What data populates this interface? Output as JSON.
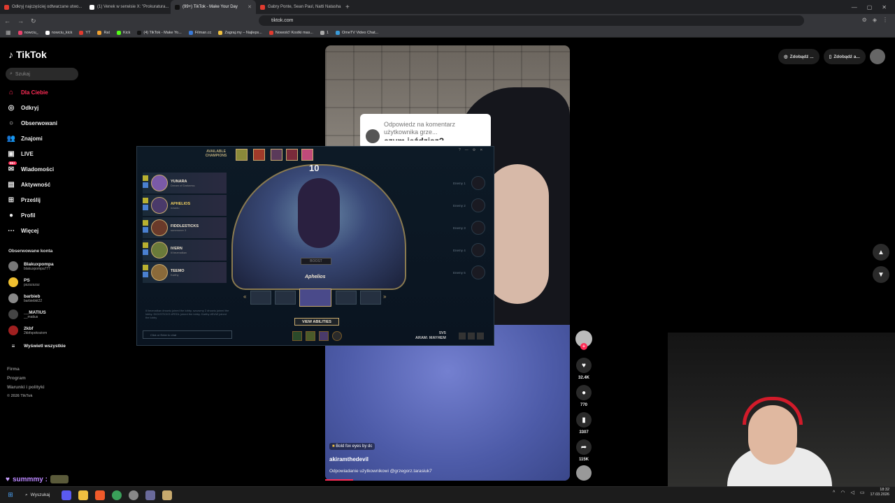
{
  "browser": {
    "tabs": [
      {
        "label": "Odkryj najczęściej odtwarzane utwo...",
        "color": "#e03b2f"
      },
      {
        "label": "(1) Venek w serwisie X: \"Prokuratura...",
        "color": "#ffffff"
      },
      {
        "label": "(99+) TikTok - Make Your Day",
        "color": "#111111",
        "active": true
      },
      {
        "label": "Gabry Ponte, Sean Paul, Natti Natasha...",
        "color": "#e03b2f"
      }
    ],
    "new_tab": "+",
    "url": "tiktok.com",
    "bookmarks": [
      {
        "label": "nowciu_",
        "color": "#e8436c"
      },
      {
        "label": "nowciu_kick",
        "color": "#ffffff"
      },
      {
        "label": "YT",
        "color": "#e03b2f"
      },
      {
        "label": "Rat",
        "color": "#f0a030"
      },
      {
        "label": "Kick",
        "color": "#53fc18"
      },
      {
        "label": "(4) TikTok - Make Yo...",
        "color": "#111111"
      },
      {
        "label": "Filman.cc",
        "color": "#3a7ad8"
      },
      {
        "label": "Zagraj.my – Najleps...",
        "color": "#f0c040"
      },
      {
        "label": "Nowość! Kostki mas...",
        "color": "#e03b2f"
      },
      {
        "label": "1",
        "color": "#aaaaaa"
      },
      {
        "label": "OmeTV Video Chat...",
        "color": "#3a9ad8"
      }
    ]
  },
  "tiktok": {
    "logo": "TikTok",
    "search_placeholder": "Szukaj",
    "nav": [
      {
        "label": "Dla Ciebie",
        "icon": "home-icon",
        "glyph": "⌂",
        "active": true
      },
      {
        "label": "Odkryj",
        "icon": "compass-icon",
        "glyph": "◎"
      },
      {
        "label": "Obserwowani",
        "icon": "following-icon",
        "glyph": "○"
      },
      {
        "label": "Znajomi",
        "icon": "friends-icon",
        "glyph": "👥"
      },
      {
        "label": "LIVE",
        "icon": "live-icon",
        "glyph": "▣"
      },
      {
        "label": "Wiadomości",
        "icon": "messages-icon",
        "glyph": "✉",
        "badge": "99+"
      },
      {
        "label": "Aktywność",
        "icon": "activity-icon",
        "glyph": "▤"
      },
      {
        "label": "Prześlij",
        "icon": "upload-icon",
        "glyph": "⊞"
      },
      {
        "label": "Profil",
        "icon": "profile-icon",
        "glyph": "●"
      },
      {
        "label": "Więcej",
        "icon": "more-icon",
        "glyph": "⋯"
      }
    ],
    "followed_header": "Obserwowane konta",
    "followed": [
      {
        "name": "Blakuxpompa",
        "handle": "blakuxpompa777",
        "color": "#777"
      },
      {
        "name": "PS",
        "handle": "pszszszsz",
        "color": "#f0c030"
      },
      {
        "name": "barbieb",
        "handle": "barbiebkt22",
        "color": "#888"
      },
      {
        "name": "__MATIUS",
        "handle": "__matius",
        "color": "#444"
      },
      {
        "name": "2kbf",
        "handle": "2kbfspokoziom",
        "color": "#a02020"
      }
    ],
    "show_all": "Wyświetl wszystkie",
    "footer": [
      "Firma",
      "Program",
      "Warunki i polityki",
      "© 2026 TikTok"
    ],
    "top_right": [
      "Zdobądź ...",
      "Zdobądź a..."
    ],
    "video": {
      "reply_text": "Odpowiedz na komentarz użytkownika grze...",
      "reply_partial": "czym jeździsz?",
      "tag": "Bold fox eyes by dc",
      "author": "akiramthedevil",
      "caption": "Odpowiadanie użytkownikowi @grzegorz.tarasiuk7"
    },
    "actions": {
      "likes": "32.4K",
      "comments": "770",
      "saves": "3307",
      "shares": "115K"
    }
  },
  "game": {
    "header": "AVAILABLE CHAMPIONS",
    "timer": "10",
    "team": [
      {
        "name": "YUNARA",
        "sub": "Dream of Darkness",
        "color": "#7a5aa8"
      },
      {
        "name": "APHELIOS",
        "sub": "nowciu",
        "color": "#4a3a6a",
        "highlight": true
      },
      {
        "name": "FIDDLESTICKS",
        "sub": "summoner 3",
        "color": "#6a3a2a"
      },
      {
        "name": "IVERN",
        "sub": "lil bezmatkav",
        "color": "#6a7a3a"
      },
      {
        "name": "TEEMO",
        "sub": "Karthy",
        "color": "#8a6a3a"
      }
    ],
    "enemies": [
      "Enemy 1",
      "Enemy 2",
      "Enemy 3",
      "Enemy 4",
      "Enemy 5"
    ],
    "boost": "BOOST",
    "champion": "Aphelios",
    "chat_log": "lil bezmatkav #nowiu joined the lobby. szczurny 2 #nowiu joined the lobby. DICKSTICKS #FEDL joined the lobby. Karthy #EUW joined the lobby",
    "chat_input": "Click or Enter to chat",
    "view_abilities": "VIEW ABILITIES",
    "mode_line1": "5V5",
    "mode_line2": "ARAM: MAYHEM"
  },
  "stream": {
    "chat_user": "summmy :"
  },
  "taskbar": {
    "search": "Wyszukaj",
    "time": "18:32",
    "date": "17.03.2026"
  }
}
